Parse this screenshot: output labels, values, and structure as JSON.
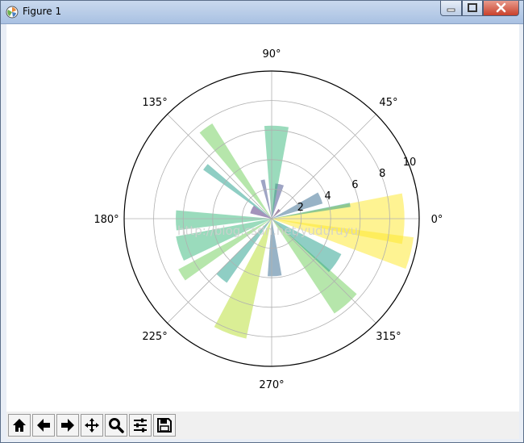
{
  "window": {
    "title": "Figure 1"
  },
  "chart_data": {
    "type": "bar",
    "projection": "polar",
    "title": "",
    "rlim": [
      0,
      10
    ],
    "radial_ticks": [
      "2",
      "4",
      "6",
      "8",
      "10"
    ],
    "angle_ticks": [
      "0°",
      "45°",
      "90°",
      "135°",
      "180°",
      "225°",
      "270°",
      "315°"
    ],
    "grid": true,
    "colormap": "viridis",
    "alpha": 0.5,
    "bars": [
      {
        "theta_deg": 0,
        "width_deg": 22,
        "r": 9.0
      },
      {
        "theta_deg": 10,
        "width_deg": 3,
        "r": 5.4
      },
      {
        "theta_deg": 23,
        "width_deg": 13,
        "r": 3.6
      },
      {
        "theta_deg": 48,
        "width_deg": 14,
        "r": 0.8
      },
      {
        "theta_deg": 77,
        "width_deg": 14,
        "r": 2.4
      },
      {
        "theta_deg": 87,
        "width_deg": 15,
        "r": 6.3
      },
      {
        "theta_deg": 103,
        "width_deg": 6,
        "r": 2.7
      },
      {
        "theta_deg": 126,
        "width_deg": 8,
        "r": 7.6
      },
      {
        "theta_deg": 142,
        "width_deg": 5,
        "r": 5.7
      },
      {
        "theta_deg": 155,
        "width_deg": 22,
        "r": 1.5
      },
      {
        "theta_deg": 181,
        "width_deg": 12,
        "r": 6.5
      },
      {
        "theta_deg": 198,
        "width_deg": 15,
        "r": 6.6
      },
      {
        "theta_deg": 212,
        "width_deg": 7,
        "r": 7.2
      },
      {
        "theta_deg": 230,
        "width_deg": 10,
        "r": 5.3
      },
      {
        "theta_deg": 250,
        "width_deg": 16,
        "r": 8.3
      },
      {
        "theta_deg": 273,
        "width_deg": 14,
        "r": 3.9
      },
      {
        "theta_deg": 311,
        "width_deg": 15,
        "r": 7.7
      },
      {
        "theta_deg": 325,
        "width_deg": 16,
        "r": 5.3
      },
      {
        "theta_deg": 346,
        "width_deg": 13,
        "r": 9.7
      }
    ],
    "watermark": "http://blog.csdn.net/yuduruyu"
  },
  "toolbar": {
    "buttons": [
      {
        "name": "home-button",
        "icon": "home-icon"
      },
      {
        "name": "back-button",
        "icon": "arrow-left-icon"
      },
      {
        "name": "forward-button",
        "icon": "arrow-right-icon"
      },
      {
        "name": "pan-button",
        "icon": "move-icon"
      },
      {
        "name": "zoom-button",
        "icon": "magnifier-icon"
      },
      {
        "name": "configure-subplots-button",
        "icon": "sliders-icon"
      },
      {
        "name": "save-button",
        "icon": "floppy-disk-icon"
      }
    ]
  }
}
